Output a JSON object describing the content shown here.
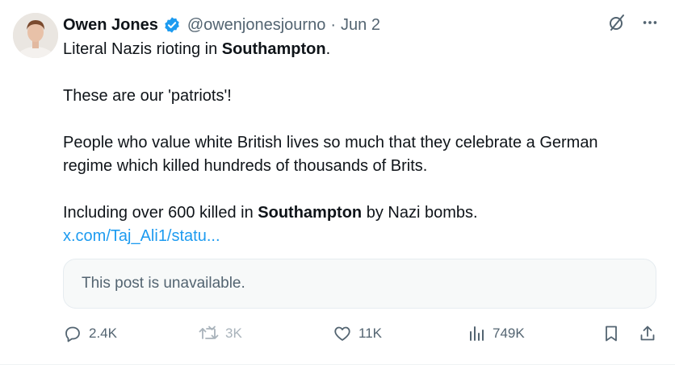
{
  "author": {
    "name": "Owen Jones",
    "handle": "@owenjonesjourno",
    "separator": "·",
    "date": "Jun 2"
  },
  "tweet": {
    "line1_pre": "Literal Nazis rioting in ",
    "line1_bold": "Southampton",
    "line1_post": ".",
    "line2": "These are our 'patriots'!",
    "line3a": "People who value white British lives so much that they celebrate a German",
    "line3b": "regime which killed hundreds of thousands of Brits.",
    "line4_pre": "Including over 600 killed in ",
    "line4_bold": "Southampton",
    "line4_post": " by Nazi bombs.",
    "link": "x.com/Taj_Ali1/statu..."
  },
  "quote": {
    "text": "This post is unavailable."
  },
  "metrics": {
    "replies": "2.4K",
    "reposts": "3K",
    "likes": "11K",
    "views": "749K"
  },
  "icons": {
    "verified": "verified-badge-icon",
    "grok": "grok-icon",
    "more": "more-icon",
    "reply": "reply-icon",
    "repost": "repost-icon",
    "like": "heart-icon",
    "views": "views-icon",
    "bookmark": "bookmark-icon",
    "share": "share-icon"
  },
  "colors": {
    "text": "#0f1419",
    "secondary": "#536471",
    "link": "#1d9bf0",
    "verified": "#1d9bf0"
  }
}
